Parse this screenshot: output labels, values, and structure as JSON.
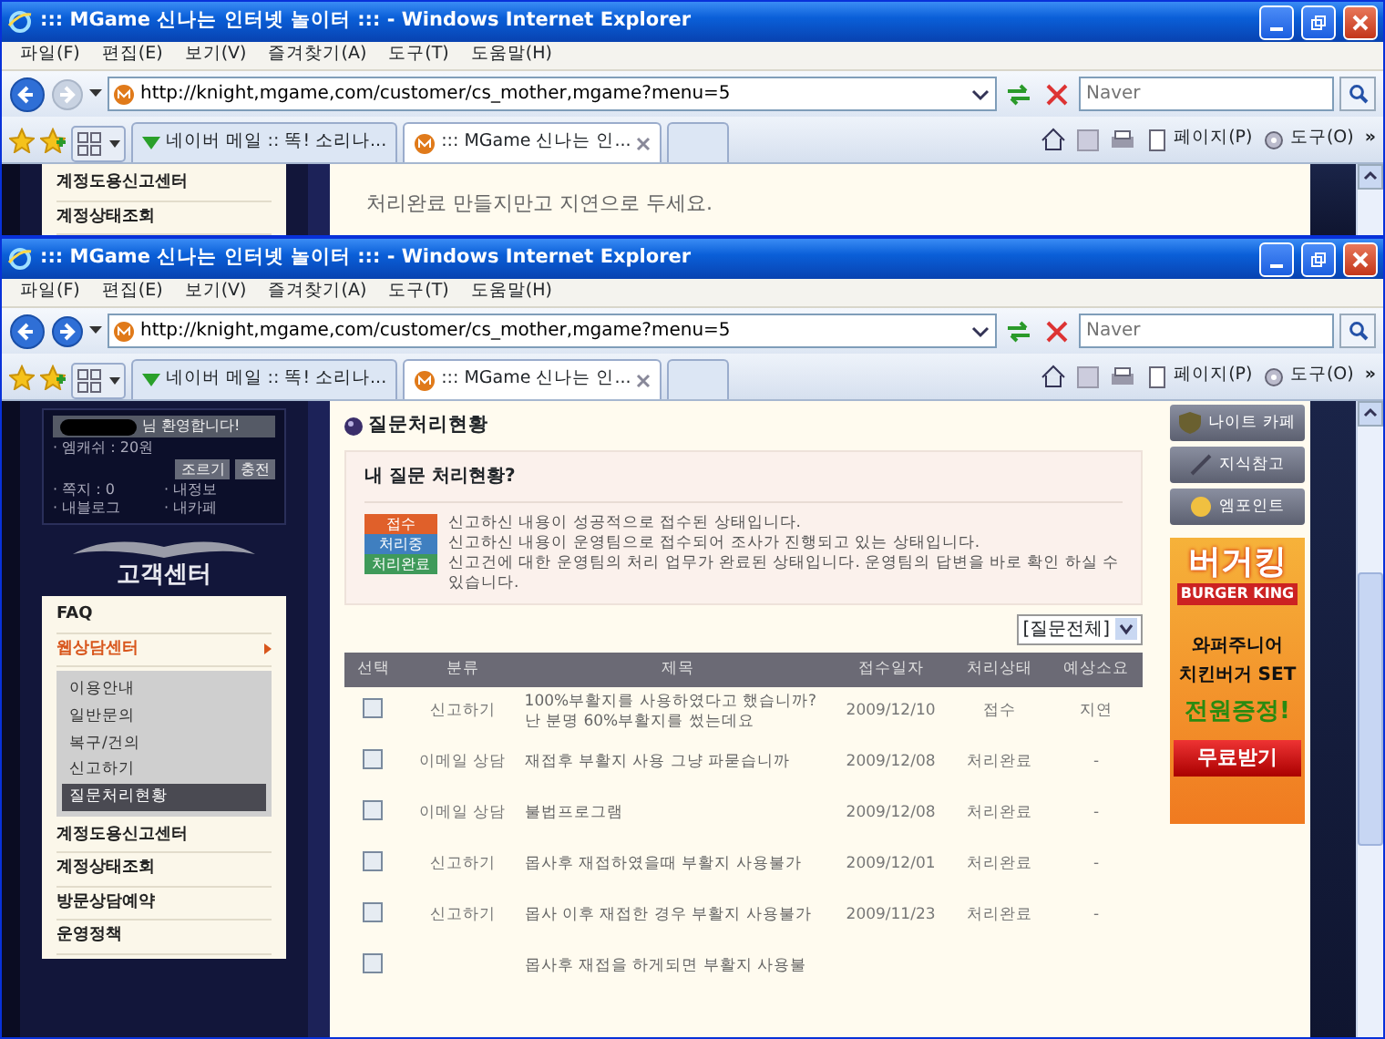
{
  "windows": [
    {
      "title": "::: MGame 신나는 인터넷 놀이터 ::: - Windows Internet Explorer",
      "menu": [
        "파일(F)",
        "편집(E)",
        "보기(V)",
        "즐겨찾기(A)",
        "도구(T)",
        "도움말(H)"
      ],
      "forward_enabled": false,
      "address": "http://knight,mgame,com/customer/cs_mother,mgame?menu=5",
      "search_placeholder": "Naver",
      "tabs": [
        {
          "label": "네이버 메일 :: 똑! 소리나...",
          "selected": false
        },
        {
          "label": "::: MGame 신나는 인...",
          "selected": true
        }
      ],
      "toolbar": [
        "페이지(P)",
        "도구(O)"
      ],
      "more": "»",
      "page": {
        "kind": "partial",
        "sidebar_items": [
          "계정도용신고센터",
          "계정상태조회"
        ],
        "text": "처리완료 만들지만고 지연으로 두세요."
      }
    },
    {
      "title": "::: MGame 신나는 인터넷 놀이터 ::: - Windows Internet Explorer",
      "menu": [
        "파일(F)",
        "편집(E)",
        "보기(V)",
        "즐겨찾기(A)",
        "도구(T)",
        "도움말(H)"
      ],
      "forward_enabled": true,
      "address": "http://knight,mgame,com/customer/cs_mother,mgame?menu=5",
      "search_placeholder": "Naver",
      "tabs": [
        {
          "label": "네이버 메일 :: 똑! 소리나...",
          "selected": false
        },
        {
          "label": "::: MGame 신나는 인...",
          "selected": true
        }
      ],
      "toolbar": [
        "페이지(P)",
        "도구(O)"
      ],
      "more": "»",
      "page": {
        "kind": "full",
        "user": {
          "greeting": "님 환영합니다!",
          "cash": "· 엠캐쉬 : 20원",
          "buttons": [
            "조르기",
            "충전"
          ],
          "links": [
            "· 쪽지 : 0",
            "· 내정보",
            "· 내블로그",
            "· 내카페"
          ]
        },
        "section_title": "고객센터",
        "menu": [
          {
            "label": "FAQ",
            "expanded": false
          },
          {
            "label": "웹상담센터",
            "expanded": true,
            "children": [
              {
                "label": "이용안내",
                "selected": false
              },
              {
                "label": "일반문의",
                "selected": false
              },
              {
                "label": "복구/건의",
                "selected": false
              },
              {
                "label": "신고하기",
                "selected": false
              },
              {
                "label": "질문처리현황",
                "selected": true
              }
            ]
          },
          {
            "label": "계정도용신고센터",
            "expanded": false
          },
          {
            "label": "계정상태조회",
            "expanded": false
          },
          {
            "label": "방문상담예약",
            "expanded": false
          },
          {
            "label": "운영정책",
            "expanded": false
          }
        ],
        "heading": "질문처리현황",
        "info": {
          "title": "내 질문 처리현황?",
          "legend": [
            {
              "badge": "접수",
              "color": "#e0602a",
              "text": "신고하신 내용이 성공적으로 접수된 상태입니다."
            },
            {
              "badge": "처리중",
              "color": "#3f7fc0",
              "text": "신고하신 내용이 운영팀으로 접수되어 조사가 진행되고 있는 상태입니다."
            },
            {
              "badge": "처리완료",
              "color": "#3f9a5a",
              "text": "신고건에 대한 운영팀의 처리 업무가 완료된 상태입니다. 운영팀의 답변을 바로 확인 하실 수 있습니다."
            }
          ]
        },
        "filter": "[질문전체]",
        "table": {
          "columns": [
            "선택",
            "분류",
            "제목",
            "접수일자",
            "처리상태",
            "예상소요"
          ],
          "rows": [
            {
              "checked": false,
              "category": "신고하기",
              "title": "100%부활지를 사용하였다고 했습니까? 난 분명 60%부활지를 썼는데요",
              "date": "2009/12/10",
              "status": "접수",
              "eta": "지연"
            },
            {
              "checked": false,
              "category": "이메일 상담",
              "title": "재접후 부활지 사용 그냥 파묻습니까",
              "date": "2009/12/08",
              "status": "처리완료",
              "eta": "-"
            },
            {
              "checked": false,
              "category": "이메일 상담",
              "title": "불법프로그램",
              "date": "2009/12/08",
              "status": "처리완료",
              "eta": "-"
            },
            {
              "checked": false,
              "category": "신고하기",
              "title": "몹사후 재접하였을때 부활지 사용불가",
              "date": "2009/12/01",
              "status": "처리완료",
              "eta": "-"
            },
            {
              "checked": false,
              "category": "신고하기",
              "title": "몹사 이후 재접한 경우 부활지 사용불가",
              "date": "2009/11/23",
              "status": "처리완료",
              "eta": "-"
            },
            {
              "checked": false,
              "title": "몹사후 재접을 하게되면 부활지 사용불"
            }
          ]
        },
        "quick_links": [
          "나이트 카페",
          "지식참고",
          "엠포인트"
        ],
        "ad": {
          "brand": "버거킹",
          "brand_en": "BURGER KING",
          "line1": "와퍼주니어",
          "line2": "치킨버거 SET",
          "promo": "전원증정!",
          "button": "무료받기"
        }
      }
    }
  ]
}
